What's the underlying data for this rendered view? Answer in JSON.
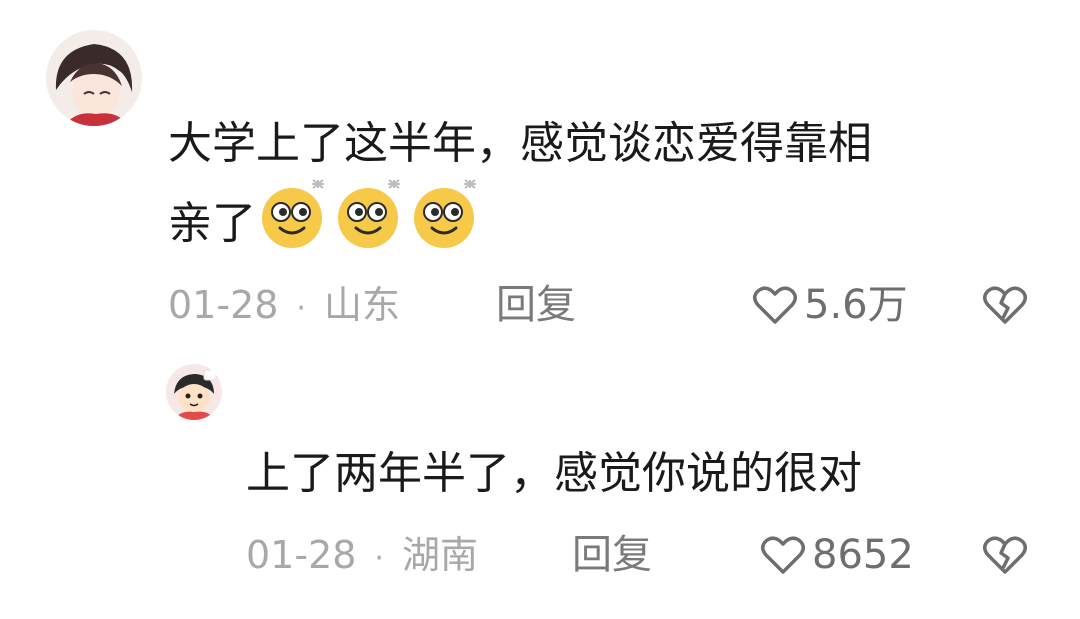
{
  "comments": [
    {
      "text": "大学上了这半年，感觉谈恋爱得靠相亲了",
      "line1": "大学上了这半年，感觉谈恋爱得靠相",
      "line2": "亲了",
      "emojis": [
        "smiling-eyes-emoji",
        "smiling-eyes-emoji",
        "smiling-eyes-emoji"
      ],
      "date": "01-28",
      "location": "山东",
      "reply_label": "回复",
      "likes": "5.6万"
    },
    {
      "text": "上了两年半了，感觉你说的很对",
      "date": "01-28",
      "location": "湖南",
      "reply_label": "回复",
      "likes": "8652"
    }
  ],
  "separator": "·",
  "icons": {
    "like": "heart-outline-icon",
    "dislike": "broken-heart-icon"
  },
  "colors": {
    "text": "#1a1a1a",
    "meta": "#a8a8a8",
    "action": "#7a7a7a",
    "emoji": "#f7c948"
  }
}
